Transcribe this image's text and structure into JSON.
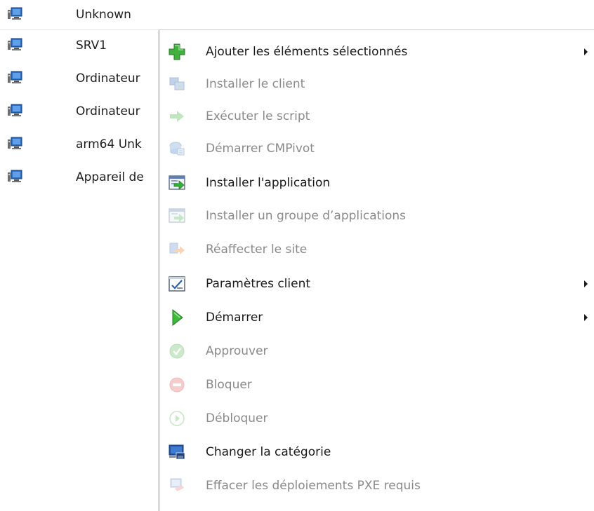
{
  "devices": [
    {
      "name": "Unknown",
      "icon": "computer-icon"
    },
    {
      "name": "SRV1",
      "icon": "computer-icon"
    },
    {
      "name": "Ordinateur",
      "icon": "computer-icon"
    },
    {
      "name": "Ordinateur",
      "icon": "computer-icon"
    },
    {
      "name": "arm64 Unk",
      "icon": "computer-icon"
    },
    {
      "name": "Appareil de",
      "icon": "computer-icon"
    }
  ],
  "menu": {
    "items": [
      {
        "label": "Ajouter les éléments sélectionnés",
        "icon": "add-icon",
        "enabled": true,
        "submenu": true
      },
      {
        "label": "Installer le client",
        "icon": "install-client-icon",
        "enabled": false,
        "submenu": false
      },
      {
        "label": "Exécuter le script",
        "icon": "run-script-icon",
        "enabled": false,
        "submenu": false
      },
      {
        "label": "Démarrer CMPivot",
        "icon": "cmpivot-icon",
        "enabled": false,
        "submenu": false
      },
      {
        "label": "Installer l'application",
        "icon": "install-application-icon",
        "enabled": true,
        "submenu": false
      },
      {
        "label": "Installer un groupe d’applications",
        "icon": "install-app-group-icon",
        "enabled": false,
        "submenu": false
      },
      {
        "label": "Réaffecter le site",
        "icon": "reassign-site-icon",
        "enabled": false,
        "submenu": false
      },
      {
        "label": "Paramètres client",
        "icon": "client-settings-icon",
        "enabled": true,
        "submenu": true
      },
      {
        "label": "Démarrer",
        "icon": "start-icon",
        "enabled": true,
        "submenu": true
      },
      {
        "label": "Approuver",
        "icon": "approve-icon",
        "enabled": false,
        "submenu": false
      },
      {
        "label": "Bloquer",
        "icon": "block-icon",
        "enabled": false,
        "submenu": false
      },
      {
        "label": "Débloquer",
        "icon": "unblock-icon",
        "enabled": false,
        "submenu": false
      },
      {
        "label": "Changer la catégorie",
        "icon": "change-category-icon",
        "enabled": true,
        "submenu": false
      },
      {
        "label": "Effacer les déploiements PXE requis",
        "icon": "clear-pxe-icon",
        "enabled": false,
        "submenu": false
      },
      {
        "label": "",
        "icon": "partial-icon",
        "enabled": false,
        "submenu": false
      }
    ]
  },
  "colors": {
    "enabled_text": "#1a1a1a",
    "disabled_text": "#8a8a8a",
    "green": "#3aa53a",
    "blue": "#2d5ea8"
  }
}
